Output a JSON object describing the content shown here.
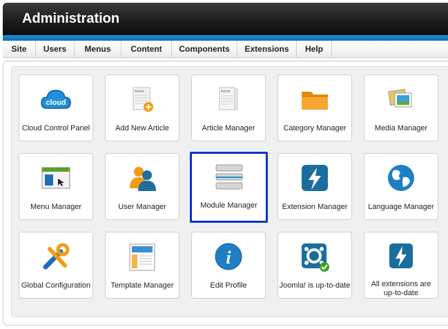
{
  "header": {
    "title": "Administration"
  },
  "menu": [
    {
      "label": "Site"
    },
    {
      "label": "Users"
    },
    {
      "label": "Menus"
    },
    {
      "label": "Content"
    },
    {
      "label": "Components"
    },
    {
      "label": "Extensions"
    },
    {
      "label": "Help"
    }
  ],
  "tiles": [
    {
      "label": "Cloud Control Panel",
      "icon": "cloud-icon",
      "icon_text": "cloud"
    },
    {
      "label": "Add New Article",
      "icon": "add-article-icon",
      "icon_text": "Article"
    },
    {
      "label": "Article Manager",
      "icon": "article-icon",
      "icon_text": "Article"
    },
    {
      "label": "Category Manager",
      "icon": "folder-icon"
    },
    {
      "label": "Media Manager",
      "icon": "media-icon"
    },
    {
      "label": "Menu Manager",
      "icon": "menu-window-icon"
    },
    {
      "label": "User Manager",
      "icon": "users-icon"
    },
    {
      "label": "Module Manager",
      "icon": "module-stack-icon",
      "selected": true
    },
    {
      "label": "Extension Manager",
      "icon": "lightning-icon"
    },
    {
      "label": "Language Manager",
      "icon": "globe-icon"
    },
    {
      "label": "Global Configuration",
      "icon": "tools-icon"
    },
    {
      "label": "Template Manager",
      "icon": "template-icon"
    },
    {
      "label": "Edit Profile",
      "icon": "info-icon",
      "icon_text": "i"
    },
    {
      "label": "Joomla! is up-to-date",
      "icon": "joomla-check-icon"
    },
    {
      "label": "All extensions are up-to-date",
      "icon": "lightning-small-icon"
    }
  ],
  "colors": {
    "accent": "#1a8fd6",
    "header": "#1a1a1a",
    "selection": "#0033cc"
  }
}
